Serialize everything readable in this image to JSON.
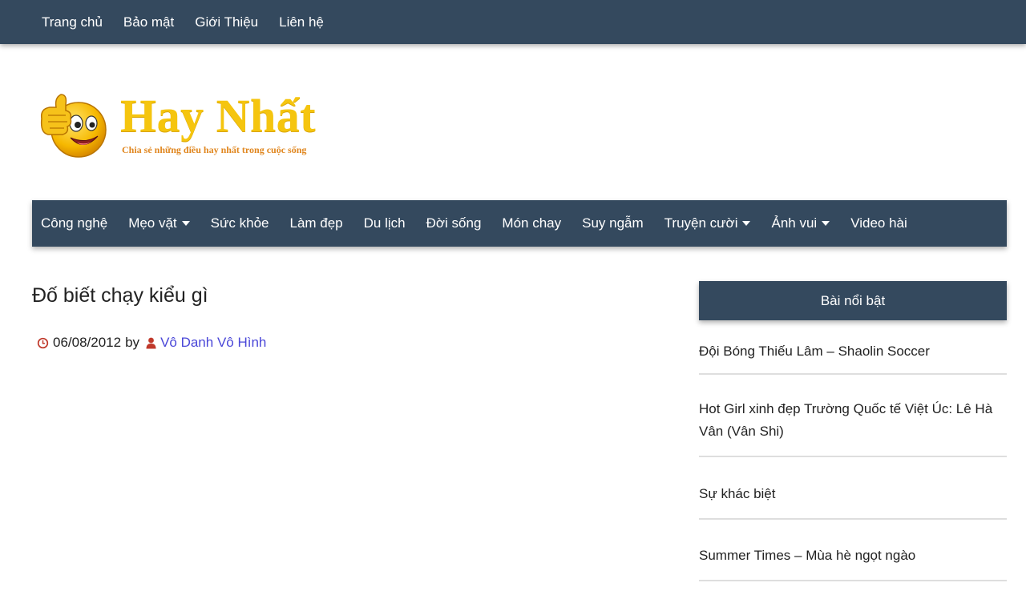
{
  "top_nav": {
    "items": [
      {
        "label": "Trang chủ"
      },
      {
        "label": "Bảo mật"
      },
      {
        "label": "Giới Thiệu"
      },
      {
        "label": "Liên hệ"
      }
    ]
  },
  "logo": {
    "title": "Hay Nhất",
    "tagline": "Chia sẻ những điều hay nhất trong cuộc sống",
    "icon": "thumbs-up-smiley-icon"
  },
  "main_nav": {
    "items": [
      {
        "label": "Công nghệ",
        "dropdown": false
      },
      {
        "label": "Mẹo vặt",
        "dropdown": true
      },
      {
        "label": "Sức khỏe",
        "dropdown": false
      },
      {
        "label": "Làm đẹp",
        "dropdown": false
      },
      {
        "label": "Du lịch",
        "dropdown": false
      },
      {
        "label": "Đời sống",
        "dropdown": false
      },
      {
        "label": "Món chay",
        "dropdown": false
      },
      {
        "label": "Suy ngẫm",
        "dropdown": false
      },
      {
        "label": "Truyện cười",
        "dropdown": true
      },
      {
        "label": "Ảnh vui",
        "dropdown": true
      },
      {
        "label": "Video hài",
        "dropdown": false
      }
    ]
  },
  "post": {
    "title": "Đố biết chạy kiểu gì",
    "date": "06/08/2012",
    "by": "by",
    "author": "Vô Danh Vô Hình"
  },
  "sidebar": {
    "widget_title": "Bài nổi bật",
    "items": [
      {
        "title": "Đội Bóng Thiếu Lâm – Shaolin Soccer"
      },
      {
        "title": "Hot Girl xinh đẹp Trường Quốc tế Việt Úc: Lê Hà Vân (Vân Shi)"
      },
      {
        "title": "Sự khác biệt"
      },
      {
        "title": "Summer Times – Mùa hè ngọt ngào"
      }
    ]
  },
  "colors": {
    "nav_bg": "#34495e",
    "logo_yellow": "#f5c50f",
    "logo_orange": "#e0861e",
    "author_link": "#4a47d8",
    "meta_icon": "#c0392b"
  }
}
